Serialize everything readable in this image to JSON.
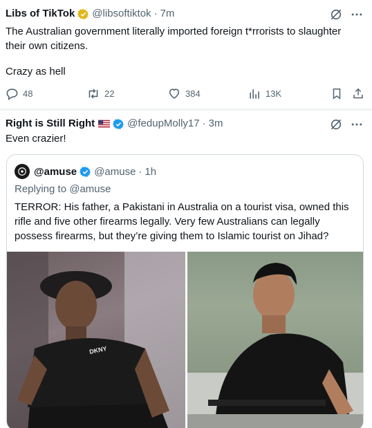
{
  "tweet1": {
    "name": "Libs of TikTok",
    "handle": "@libsoftiktok",
    "dot": "·",
    "time": "7m",
    "text_line1": "The Australian government literally imported foreign t*rrorists to slaughter their own citizens.",
    "text_line2": "Crazy as hell",
    "replies": "48",
    "reposts": "22",
    "likes": "384",
    "views": "13K",
    "badge_color": "#e2b719"
  },
  "tweet2": {
    "name": "Right is Still Right",
    "handle": "@fedupMolly17",
    "dot": "·",
    "time": "3m",
    "text": "Even crazier!",
    "badge_color": "#1d9bf0"
  },
  "quote": {
    "name": "@amuse",
    "handle": "@amuse",
    "dot": "·",
    "time": "1h",
    "replying": "Replying to @amuse",
    "text": "TERROR: His father, a Pakistani in Australia on a tourist visa, owned this rifle and five other firearms legally. Very few Australians can legally possess firearms, but they’re giving them to Islamic tourist on Jihad?",
    "shirt_text_left": "DKNY"
  },
  "icons": {
    "more": "more-icon",
    "grok": "grok-icon",
    "reply": "reply-icon",
    "repost": "repost-icon",
    "like": "heart-icon",
    "views": "views-icon",
    "bookmark": "bookmark-icon",
    "share": "share-icon"
  }
}
